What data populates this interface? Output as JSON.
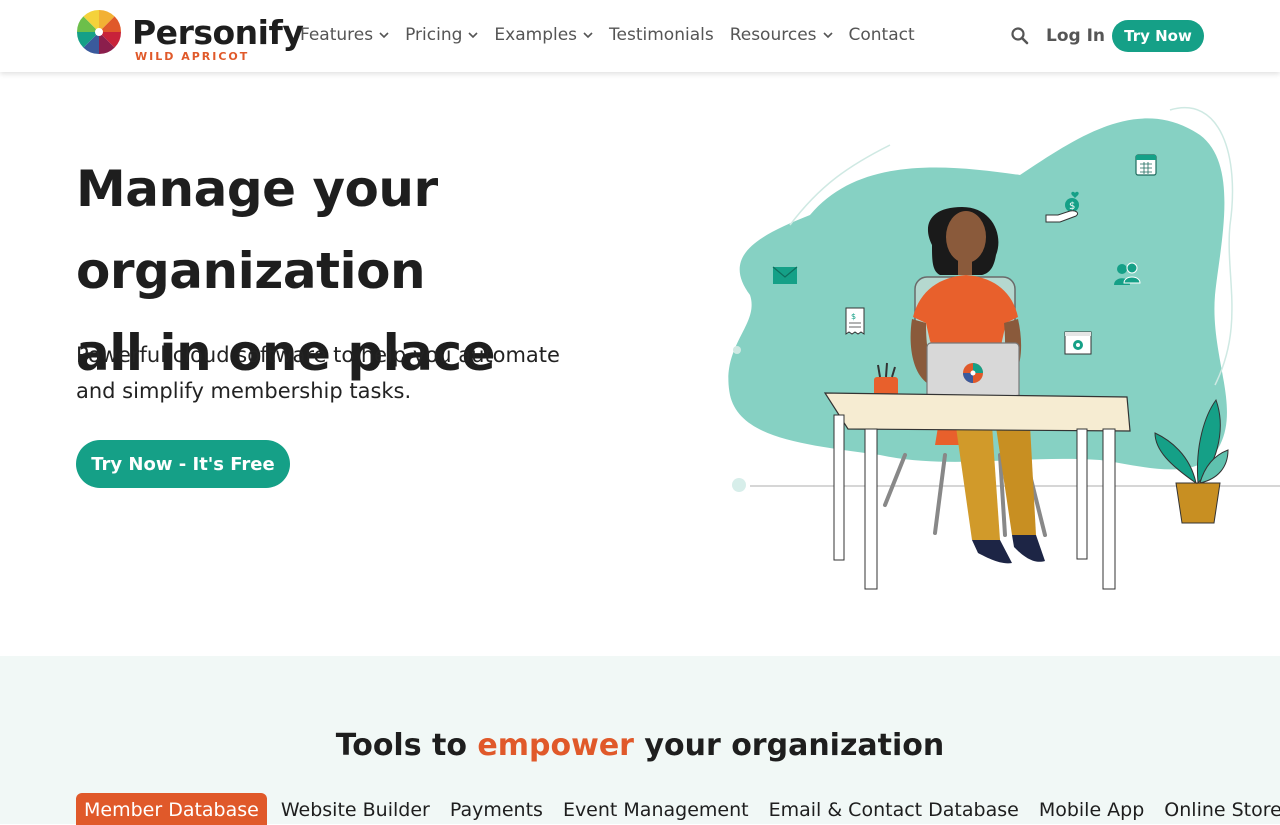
{
  "header": {
    "brand": "Personify",
    "brand_sub": "WILD APRICOT",
    "nav": [
      {
        "label": "Features",
        "dropdown": true
      },
      {
        "label": "Pricing",
        "dropdown": true
      },
      {
        "label": "Examples",
        "dropdown": true
      },
      {
        "label": "Testimonials",
        "dropdown": false
      },
      {
        "label": "Resources",
        "dropdown": true
      },
      {
        "label": "Contact",
        "dropdown": false
      }
    ],
    "login": "Log In",
    "try_now": "Try Now"
  },
  "hero": {
    "title_line1": "Manage your organization",
    "title_line2": "all in one place",
    "subtitle_line1": "Powerful cloud software to help you automate",
    "subtitle_line2": "and simplify membership tasks.",
    "cta": "Try Now - It's Free"
  },
  "tools": {
    "title_pre": "Tools to ",
    "title_highlight": "empower",
    "title_post": " your organization",
    "tabs": [
      "Member Database",
      "Website Builder",
      "Payments",
      "Event Management",
      "Email & Contact Database",
      "Mobile App",
      "Online Store"
    ],
    "active_tab": "Member Database"
  },
  "colors": {
    "accent": "#15a087",
    "orange": "#e0592a",
    "blob": "#86d1c3",
    "tools_bg": "#f1f8f6"
  },
  "icons": [
    "search-icon",
    "chevron-down-icon",
    "calendar-icon",
    "money-hand-icon",
    "envelope-icon",
    "users-icon",
    "receipt-icon",
    "gear-window-icon"
  ]
}
